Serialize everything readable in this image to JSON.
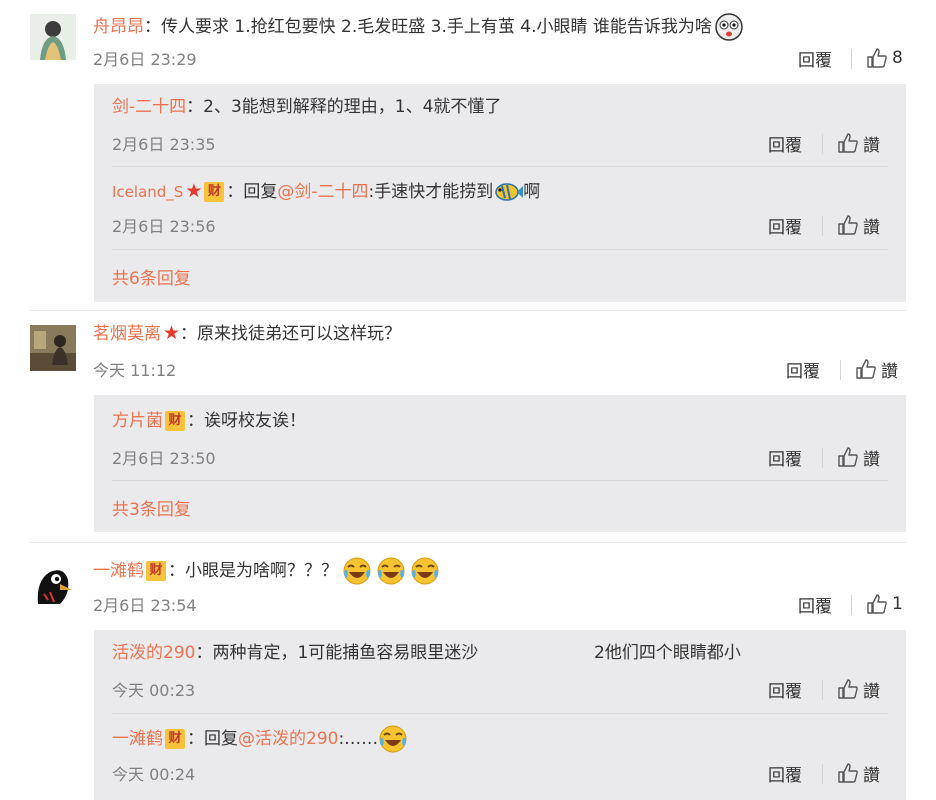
{
  "comments": [
    {
      "author": "舟昂昂",
      "text": "：传人要求 1.抢红包要快 2.毛发旺盛 3.手上有茧 4.小眼睛 谁能告诉我为啥",
      "time": "2月6日 23:29",
      "reply_label": "回覆",
      "like_count": "8",
      "replies": [
        {
          "author": "剑-二十四",
          "text": "：2、3能想到解释的理由，1、4就不懂了",
          "time": "2月6日 23:35",
          "reply_label": "回覆",
          "like_label": "讚"
        },
        {
          "author": "Iceland_S",
          "badge": "财",
          "prefix": "：回复",
          "mention": "@剑-二十四",
          "text": ":手速快才能捞到",
          "suffix": "啊",
          "time": "2月6日 23:56",
          "reply_label": "回覆",
          "like_label": "讚"
        }
      ],
      "more": "共6条回复"
    },
    {
      "author": "茗烟莫离",
      "text": "：原来找徒弟还可以这样玩？",
      "time": "今天 11:12",
      "reply_label": "回覆",
      "like_label": "讚",
      "replies": [
        {
          "author": "方片菌",
          "badge": "财",
          "text": "：诶呀校友诶！",
          "time": "2月6日 23:50",
          "reply_label": "回覆",
          "like_label": "讚"
        }
      ],
      "more": "共3条回复"
    },
    {
      "author": "一滩鹤",
      "badge": "财",
      "text": "：小眼是为啥啊？？？",
      "time": "2月6日 23:54",
      "reply_label": "回覆",
      "like_count": "1",
      "replies": [
        {
          "author": "活泼的290",
          "text": "：两种肯定，1可能捕鱼容易眼里迷沙",
          "text2": "2他们四个眼睛都小",
          "time": "今天 00:23",
          "reply_label": "回覆",
          "like_label": "讚"
        },
        {
          "author": "一滩鹤",
          "badge": "财",
          "prefix": "：回复",
          "mention": "@活泼的290",
          "text": ":……",
          "time": "今天 00:24",
          "reply_label": "回覆",
          "like_label": "讚"
        }
      ]
    }
  ],
  "colors": {
    "name": "#eb7350",
    "star": "#e8382b",
    "badge": "#f8c23a",
    "subbox": "#eaeaec"
  },
  "icons": [
    "thumbs-up-icon",
    "star-icon",
    "laugh-cry-emoji",
    "fish-emoji",
    "sticker-emoji"
  ]
}
